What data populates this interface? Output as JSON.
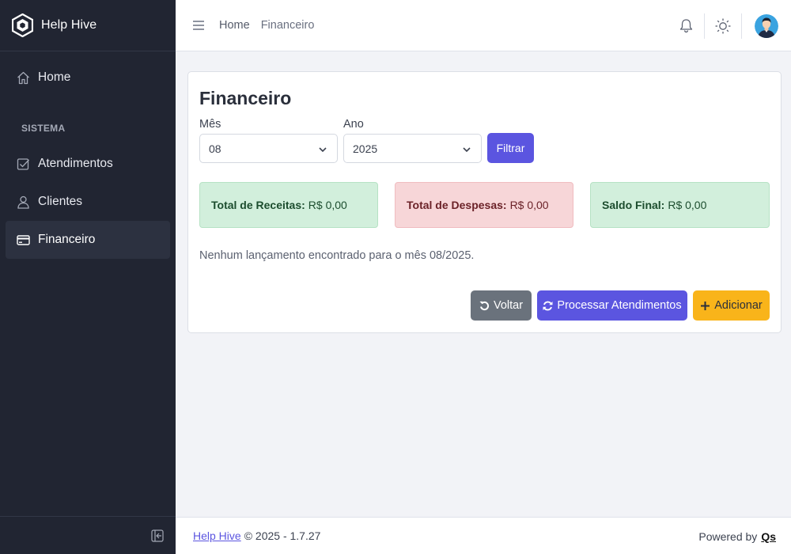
{
  "app": {
    "name": "Help Hive"
  },
  "sidebar": {
    "home": "Home",
    "section": "SISTEMA",
    "items": [
      {
        "label": "Atendimentos",
        "icon": "checkbox-icon"
      },
      {
        "label": "Clientes",
        "icon": "person-icon"
      },
      {
        "label": "Financeiro",
        "icon": "credit-card-icon",
        "active": true
      }
    ]
  },
  "topbar": {
    "breadcrumb": [
      "Home",
      "Financeiro"
    ]
  },
  "page": {
    "title": "Financeiro",
    "filters": {
      "month_label": "Mês",
      "month_value": "08",
      "year_label": "Ano",
      "year_value": "2025",
      "filter_button": "Filtrar"
    },
    "stats": {
      "income_label": "Total de Receitas:",
      "income_value": "R$ 0,00",
      "expense_label": "Total de Despesas:",
      "expense_value": "R$ 0,00",
      "balance_label": "Saldo Final:",
      "balance_value": "R$ 0,00"
    },
    "empty_message": "Nenhum lançamento encontrado para o mês 08/2025.",
    "buttons": {
      "back": "Voltar",
      "process": "Processar Atendimentos",
      "add": "Adicionar"
    }
  },
  "footer": {
    "link": "Help Hive",
    "copyright": "© 2025 - 1.7.27",
    "powered": "Powered by",
    "powered_brand": "Qs"
  },
  "colors": {
    "sidebar_bg": "#212532",
    "primary": "#5b55e0",
    "secondary": "#6a727c",
    "warning": "#f9b41a",
    "success_bg": "#d2efdc",
    "danger_bg": "#f7d6d8"
  }
}
